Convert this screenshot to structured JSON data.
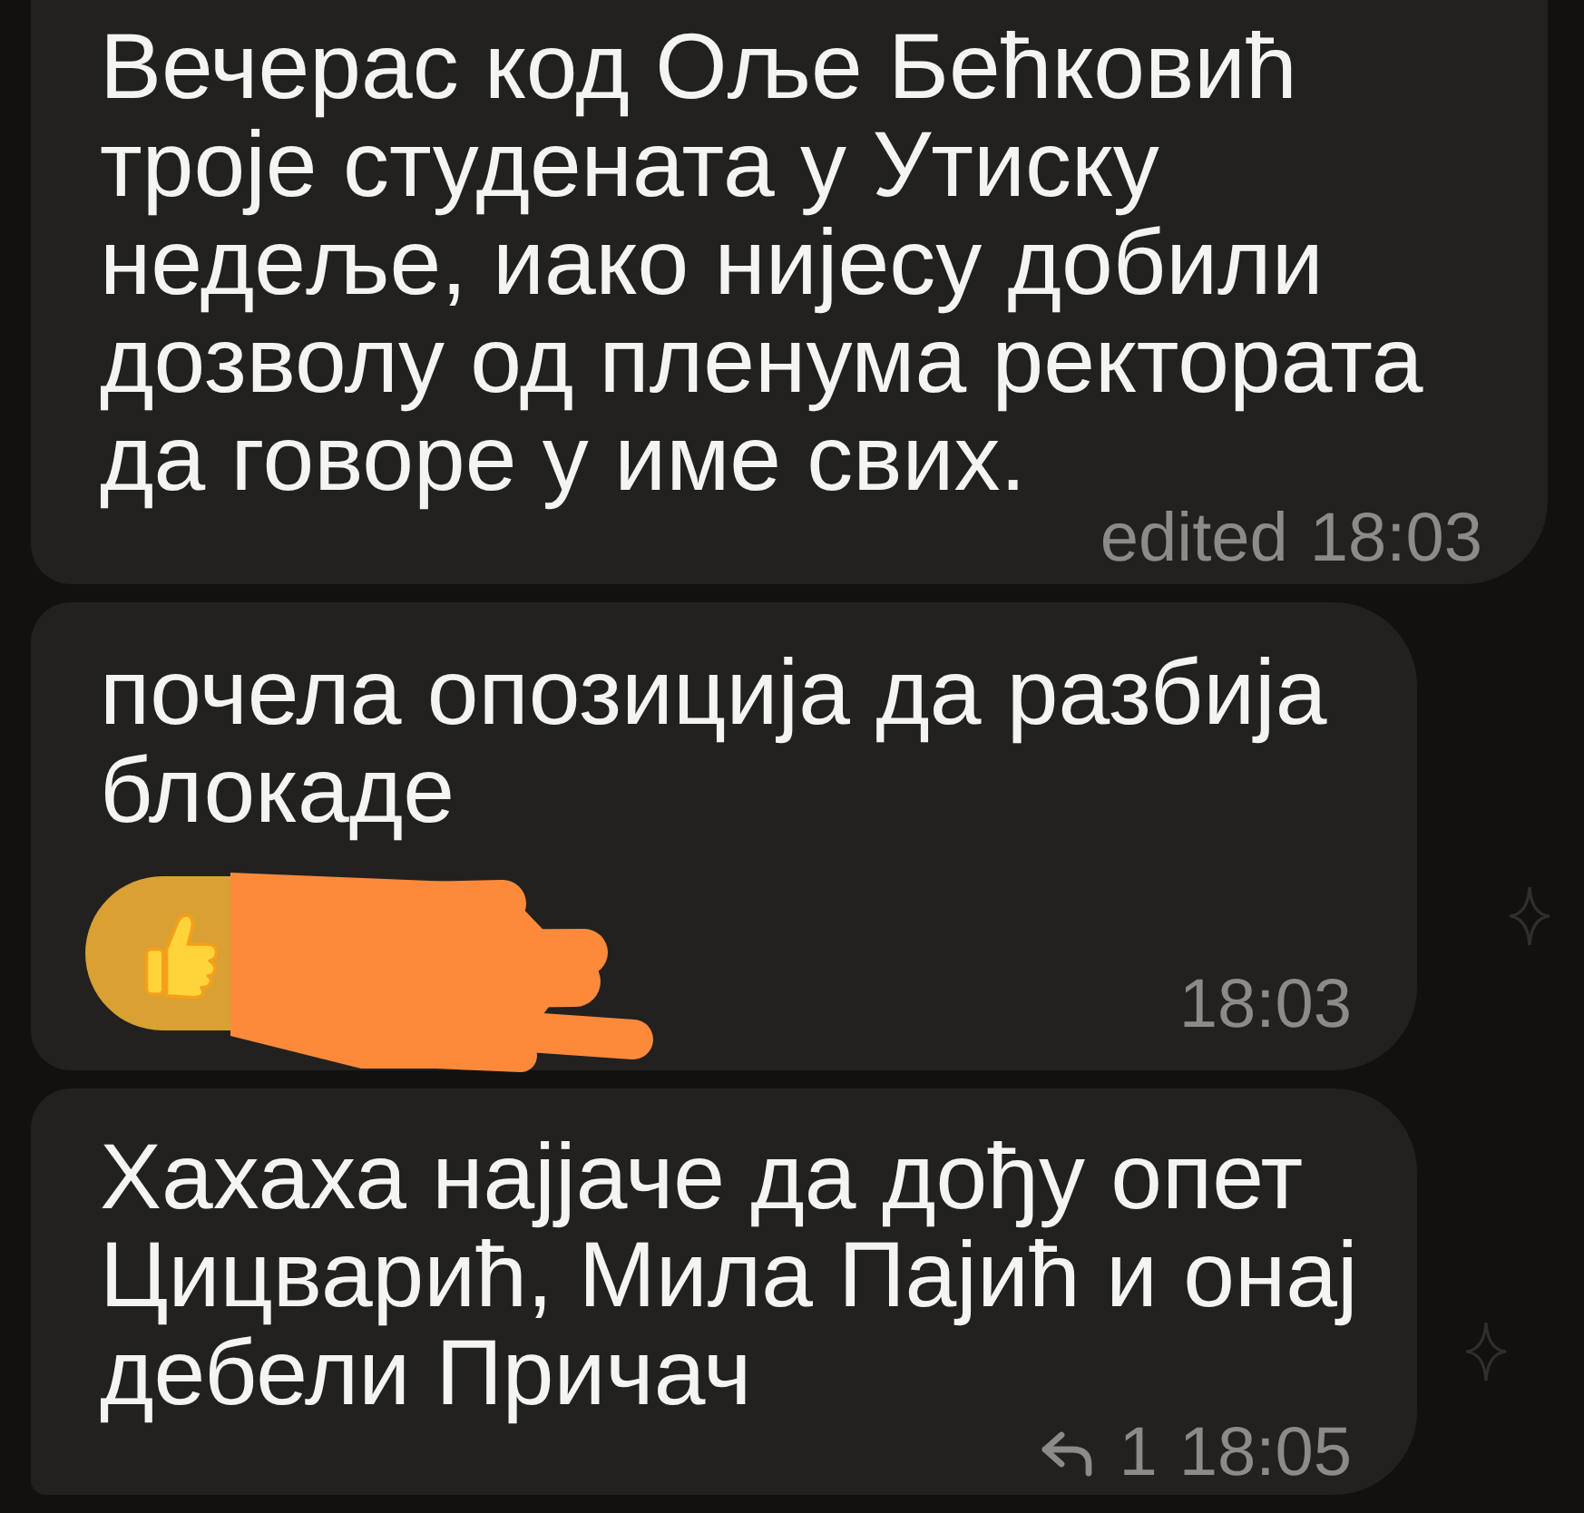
{
  "messages": [
    {
      "text": "Вечерас код Оље Бећковић троје студената у Утиску недеље, иако нијесу добили дозволу од пленума ректората да говоре у име свих.",
      "edited_label": "edited",
      "time": "18:03"
    },
    {
      "text": "почела опозиција да разбија блокаде",
      "reaction": {
        "selected": true,
        "redacted": true
      },
      "time": "18:03"
    },
    {
      "text": "Хахаха најјаче да дођу опет Цицварић, Мила Пајић и онај дебели Причач",
      "reply_count": "1",
      "time": "18:05"
    }
  ]
}
